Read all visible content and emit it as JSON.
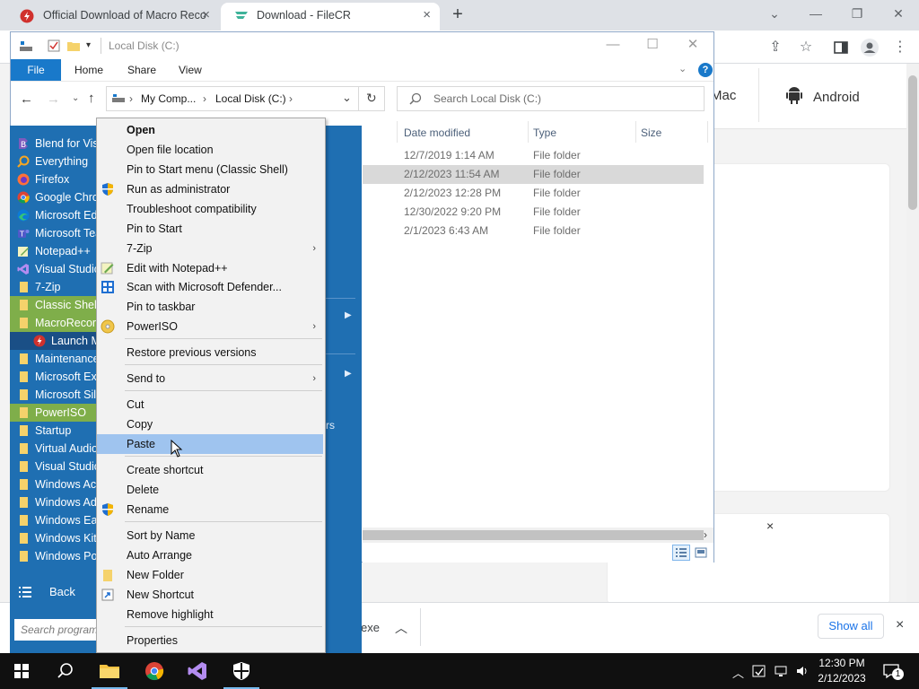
{
  "browser": {
    "tabs": [
      {
        "title": "Official Download of Macro Reco"
      },
      {
        "title": "Download - FileCR"
      }
    ],
    "new_tab": "+",
    "site_nav": {
      "mac": "Mac",
      "android": "Android"
    },
    "ad_close": "×",
    "download_bar": {
      "file_suffix": "exe",
      "show_all": "Show all",
      "close": "×"
    }
  },
  "explorer": {
    "title": "Local Disk (C:)",
    "ribbon_tabs": [
      "File",
      "Home",
      "Share",
      "View"
    ],
    "help": "?",
    "breadcrumb": [
      "My Comp...",
      "Local Disk (C:)"
    ],
    "search_placeholder": "Search Local Disk (C:)",
    "columns": {
      "date": "Date modified",
      "type": "Type",
      "size": "Size"
    },
    "rows": [
      {
        "date": "12/7/2019 1:14 AM",
        "type": "File folder",
        "selected": false
      },
      {
        "date": "2/12/2023 11:54 AM",
        "type": "File folder",
        "selected": true
      },
      {
        "date": "2/12/2023 12:28 PM",
        "type": "File folder",
        "selected": false
      },
      {
        "date": "12/30/2022 9:20 PM",
        "type": "File folder",
        "selected": false
      },
      {
        "date": "2/1/2023 6:43 AM",
        "type": "File folder",
        "selected": false
      }
    ]
  },
  "start_menu": {
    "items": [
      {
        "label": "Blend for Visual Studio",
        "icon": "blend-icon"
      },
      {
        "label": "Everything",
        "icon": "search-icon"
      },
      {
        "label": "Firefox",
        "icon": "firefox-icon"
      },
      {
        "label": "Google Chrome",
        "icon": "chrome-icon"
      },
      {
        "label": "Microsoft Edge",
        "icon": "edge-icon"
      },
      {
        "label": "Microsoft Teams",
        "icon": "teams-icon"
      },
      {
        "label": "Notepad++",
        "icon": "notepadpp-icon"
      },
      {
        "label": "Visual Studio",
        "icon": "visual-studio-icon"
      },
      {
        "label": "7-Zip",
        "icon": "folder-icon"
      },
      {
        "label": "Classic Shell",
        "icon": "folder-icon"
      },
      {
        "label": "MacroRecorder",
        "icon": "folder-icon"
      },
      {
        "label": "Launch MacroRecorder",
        "icon": "macrorecorder-icon"
      },
      {
        "label": "Maintenance",
        "icon": "folder-icon"
      },
      {
        "label": "Microsoft Excel",
        "icon": "folder-icon"
      },
      {
        "label": "Microsoft Silverlight",
        "icon": "folder-icon"
      },
      {
        "label": "PowerISO",
        "icon": "folder-icon"
      },
      {
        "label": "Startup",
        "icon": "folder-icon"
      },
      {
        "label": "Virtual Audio",
        "icon": "folder-icon"
      },
      {
        "label": "Visual Studio",
        "icon": "folder-icon"
      },
      {
        "label": "Windows Accessories",
        "icon": "folder-icon"
      },
      {
        "label": "Windows Administrative Tools",
        "icon": "folder-icon"
      },
      {
        "label": "Windows Ease of Access",
        "icon": "folder-icon"
      },
      {
        "label": "Windows Kits",
        "icon": "folder-icon"
      },
      {
        "label": "Windows PowerShell",
        "icon": "folder-icon"
      }
    ],
    "back": "Back",
    "search_placeholder": "Search programs and files",
    "right_text": "rs"
  },
  "context_menu": {
    "items": [
      {
        "label": "Open"
      },
      {
        "label": "Open file location"
      },
      {
        "label": "Pin to Start menu (Classic Shell)"
      },
      {
        "label": "Run as administrator"
      },
      {
        "label": "Troubleshoot compatibility"
      },
      {
        "label": "Pin to Start"
      },
      {
        "label": "7-Zip"
      },
      {
        "label": "Edit with Notepad++"
      },
      {
        "label": "Scan with Microsoft Defender..."
      },
      {
        "label": "Pin to taskbar"
      },
      {
        "label": "PowerISO"
      },
      {
        "label": "Restore previous versions"
      },
      {
        "label": "Send to"
      },
      {
        "label": "Cut"
      },
      {
        "label": "Copy"
      },
      {
        "label": "Paste"
      },
      {
        "label": "Create shortcut"
      },
      {
        "label": "Delete"
      },
      {
        "label": "Rename"
      },
      {
        "label": "Sort by Name"
      },
      {
        "label": "Auto Arrange"
      },
      {
        "label": "New Folder"
      },
      {
        "label": "New Shortcut"
      },
      {
        "label": "Remove highlight"
      },
      {
        "label": "Properties"
      }
    ]
  },
  "taskbar": {
    "time": "12:30 PM",
    "date": "2/12/2023",
    "notification_count": "1"
  },
  "colors": {
    "start_menu_bg": "#1f6fb2",
    "start_highlight": "#7fae4a",
    "context_hover": "#9fc4ef",
    "explorer_file_tab": "#1979ca",
    "taskbar": "#101010"
  }
}
